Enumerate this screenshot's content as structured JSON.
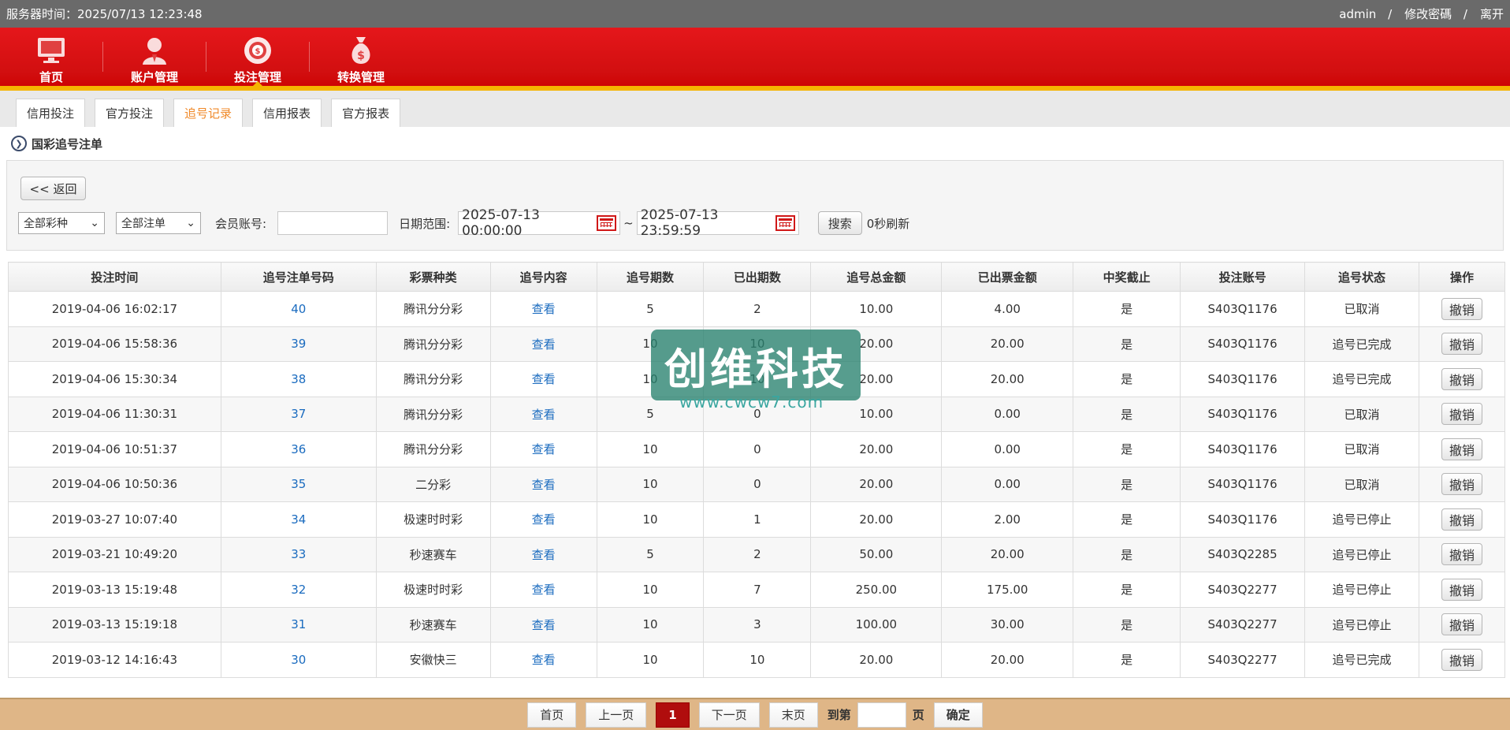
{
  "topbar": {
    "server_time": "服务器时间：2025/07/13 12:23:48",
    "user": "admin",
    "change_password": "修改密碼",
    "logout": "离开"
  },
  "nav": {
    "items": [
      {
        "label": "首页",
        "icon": "monitor-icon"
      },
      {
        "label": "账户管理",
        "icon": "user-icon"
      },
      {
        "label": "投注管理",
        "icon": "chip-icon"
      },
      {
        "label": "转换管理",
        "icon": "money-bag-icon"
      }
    ],
    "active": "投注管理"
  },
  "tabs": [
    {
      "label": "信用投注"
    },
    {
      "label": "官方投注"
    },
    {
      "label": "追号记录"
    },
    {
      "label": "信用报表"
    },
    {
      "label": "官方报表"
    }
  ],
  "active_tab": "追号记录",
  "section_title": "国彩追号注单",
  "filters": {
    "back_label": "<< 返回",
    "lottery_select": "全部彩种",
    "order_select": "全部注单",
    "member_label": "会员账号:",
    "member_value": "",
    "date_label": "日期范围:",
    "date_from": "2025-07-13 00:00:00",
    "date_sep": "~",
    "date_to": "2025-07-13 23:59:59",
    "search_label": "搜索",
    "refresh_text": "0秒刷新"
  },
  "table": {
    "headers": [
      "投注时间",
      "追号注单号码",
      "彩票种类",
      "追号内容",
      "追号期数",
      "已出期数",
      "追号总金额",
      "已出票金额",
      "中奖截止",
      "投注账号",
      "追号状态",
      "操作"
    ],
    "view_label": "查看",
    "cancel_label": "撤销",
    "rows": [
      {
        "time": "2019-04-06 16:02:17",
        "id": "40",
        "lottery": "腾讯分分彩",
        "periods": "5",
        "done": "2",
        "total": "10.00",
        "issued": "4.00",
        "stop": "是",
        "account": "S403Q1176",
        "status": "已取消"
      },
      {
        "time": "2019-04-06 15:58:36",
        "id": "39",
        "lottery": "腾讯分分彩",
        "periods": "10",
        "done": "10",
        "total": "20.00",
        "issued": "20.00",
        "stop": "是",
        "account": "S403Q1176",
        "status": "追号已完成"
      },
      {
        "time": "2019-04-06 15:30:34",
        "id": "38",
        "lottery": "腾讯分分彩",
        "periods": "10",
        "done": "10",
        "total": "20.00",
        "issued": "20.00",
        "stop": "是",
        "account": "S403Q1176",
        "status": "追号已完成"
      },
      {
        "time": "2019-04-06 11:30:31",
        "id": "37",
        "lottery": "腾讯分分彩",
        "periods": "5",
        "done": "0",
        "total": "10.00",
        "issued": "0.00",
        "stop": "是",
        "account": "S403Q1176",
        "status": "已取消"
      },
      {
        "time": "2019-04-06 10:51:37",
        "id": "36",
        "lottery": "腾讯分分彩",
        "periods": "10",
        "done": "0",
        "total": "20.00",
        "issued": "0.00",
        "stop": "是",
        "account": "S403Q1176",
        "status": "已取消"
      },
      {
        "time": "2019-04-06 10:50:36",
        "id": "35",
        "lottery": "二分彩",
        "periods": "10",
        "done": "0",
        "total": "20.00",
        "issued": "0.00",
        "stop": "是",
        "account": "S403Q1176",
        "status": "已取消"
      },
      {
        "time": "2019-03-27 10:07:40",
        "id": "34",
        "lottery": "极速时时彩",
        "periods": "10",
        "done": "1",
        "total": "20.00",
        "issued": "2.00",
        "stop": "是",
        "account": "S403Q1176",
        "status": "追号已停止"
      },
      {
        "time": "2019-03-21 10:49:20",
        "id": "33",
        "lottery": "秒速赛车",
        "periods": "5",
        "done": "2",
        "total": "50.00",
        "issued": "20.00",
        "stop": "是",
        "account": "S403Q2285",
        "status": "追号已停止"
      },
      {
        "time": "2019-03-13 15:19:48",
        "id": "32",
        "lottery": "极速时时彩",
        "periods": "10",
        "done": "7",
        "total": "250.00",
        "issued": "175.00",
        "stop": "是",
        "account": "S403Q2277",
        "status": "追号已停止"
      },
      {
        "time": "2019-03-13 15:19:18",
        "id": "31",
        "lottery": "秒速赛车",
        "periods": "10",
        "done": "3",
        "total": "100.00",
        "issued": "30.00",
        "stop": "是",
        "account": "S403Q2277",
        "status": "追号已停止"
      },
      {
        "time": "2019-03-12 14:16:43",
        "id": "30",
        "lottery": "安徽快三",
        "periods": "10",
        "done": "10",
        "total": "20.00",
        "issued": "20.00",
        "stop": "是",
        "account": "S403Q2277",
        "status": "追号已完成"
      }
    ]
  },
  "pager": {
    "first": "首页",
    "prev": "上一页",
    "current": "1",
    "next": "下一页",
    "last": "末页",
    "goto_prefix": "到第",
    "goto_suffix": "页",
    "confirm": "确定"
  },
  "watermark": {
    "text": "创维科技",
    "url": "www.cwcw7.com"
  },
  "colors": {
    "nav_red": "#d20f10",
    "nav_stripe": "#f5b400",
    "link_blue": "#1a6bbf",
    "active_tab": "#f08a2a",
    "pager_bg": "#dfb687",
    "current_page": "#b00d0d"
  }
}
